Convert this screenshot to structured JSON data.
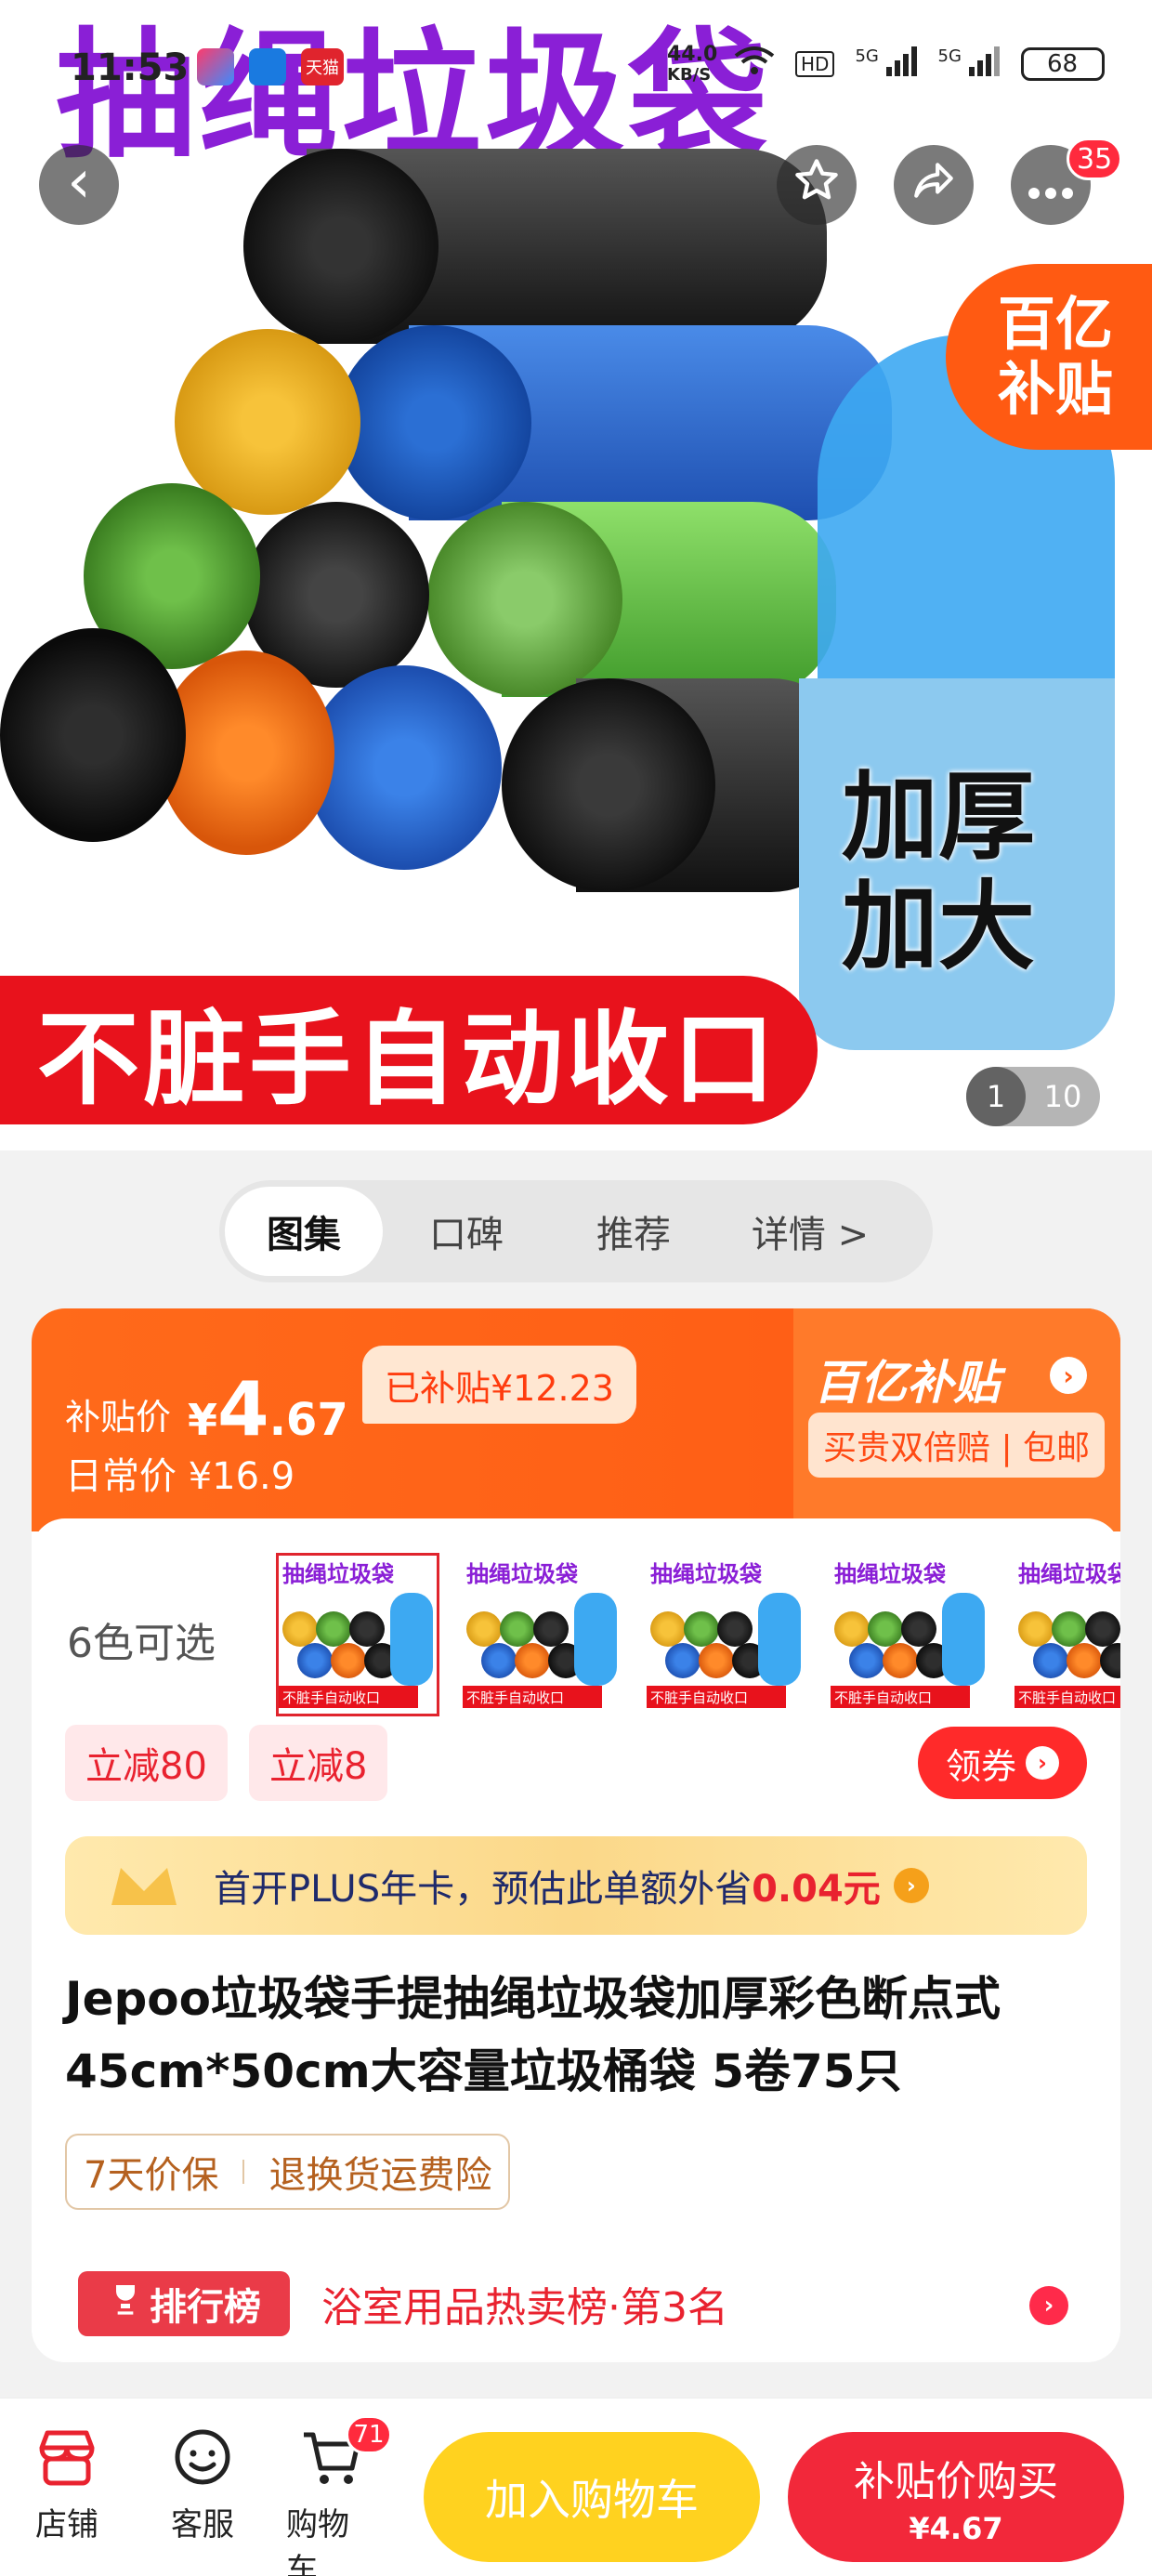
{
  "hero": {
    "title": "抽绳垃圾袋",
    "banner_text": "不脏手自动收口",
    "bucket_text_line1": "加厚",
    "bucket_text_line2": "加大",
    "subsidy_badge_line1": "百亿",
    "subsidy_badge_line2": "补贴",
    "pager_current": "1",
    "pager_total": "10"
  },
  "status": {
    "time": "11:53",
    "app3": "天猫",
    "speed_value": "44.0",
    "speed_unit": "KB/S",
    "hd": "HD",
    "net1": "5G",
    "net2": "5G",
    "battery": "68"
  },
  "top_actions": {
    "back_icon": "‹",
    "more_badge": "35"
  },
  "tabs": [
    "图集",
    "口碑",
    "推荐",
    "详情 >"
  ],
  "price": {
    "label": "补贴价",
    "yen": "¥",
    "int": "4",
    "dec": ".67",
    "subsidized_tag": "已补贴¥12.23",
    "daily_price": "日常价 ¥16.9",
    "logo": "百亿补贴",
    "guarantee": "买贵双倍赔 | 包邮"
  },
  "variants": {
    "label": "6色可选",
    "thumb_title": "抽绳垃圾袋",
    "thumb_bar": "不脏手自动收口",
    "count": 5
  },
  "discounts": [
    "立减80",
    "立减8"
  ],
  "coupon_button": "领券",
  "plus_bar": {
    "prefix": "首开PLUS年卡，预估此单额外省",
    "amount": "0.04元"
  },
  "product_title": "Jepoo垃圾袋手提抽绳垃圾袋加厚彩色断点式45cm*50cm大容量垃圾桶袋 5卷75只",
  "guarantees": [
    "7天价保",
    "退换货运费险"
  ],
  "ranking": {
    "badge": "排行榜",
    "text": "浴室用品热卖榜·第3名"
  },
  "bottom_nav": {
    "store": "店铺",
    "service": "客服",
    "cart": "购物车",
    "cart_badge": "71",
    "add_cart": "加入购物车",
    "buy_label": "补贴价购买",
    "buy_price": "¥4.67"
  },
  "colors": {
    "accent_orange": "#ff5a14",
    "buy_red": "#f2283a",
    "add_cart_yellow": "#ffd21f",
    "title_purple": "#8a1fd6"
  }
}
